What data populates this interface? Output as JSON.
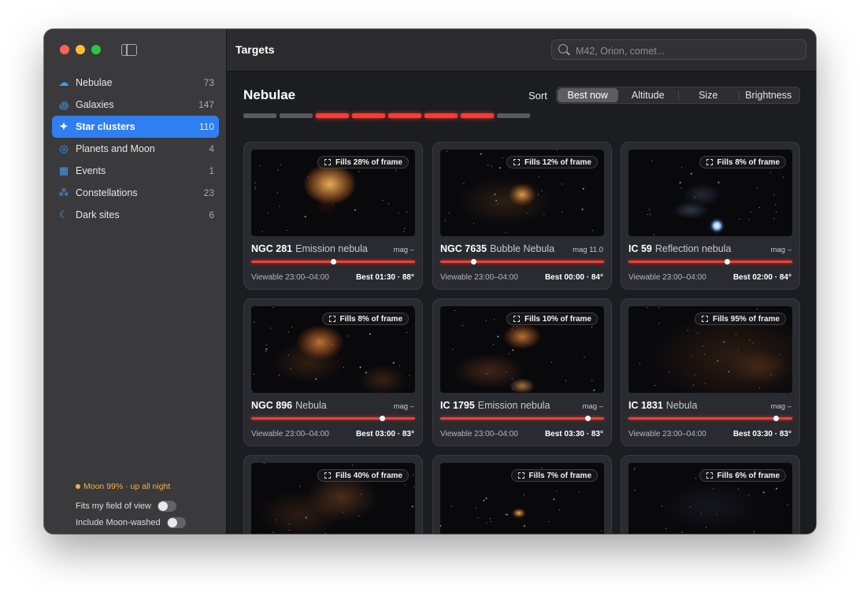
{
  "window": {
    "title": "Targets"
  },
  "search": {
    "placeholder": "M42, Orion, comet..."
  },
  "sidebar": {
    "items": [
      {
        "label": "Nebulae",
        "count": "73",
        "icon": "cloud-icon"
      },
      {
        "label": "Galaxies",
        "count": "147",
        "icon": "galaxy-icon"
      },
      {
        "label": "Star clusters",
        "count": "110",
        "icon": "sparkles-icon",
        "active": true
      },
      {
        "label": "Planets and Moon",
        "count": "4",
        "icon": "planet-icon"
      },
      {
        "label": "Events",
        "count": "1",
        "icon": "calendar-icon"
      },
      {
        "label": "Constellations",
        "count": "23",
        "icon": "constellation-icon"
      },
      {
        "label": "Dark sites",
        "count": "6",
        "icon": "moon-icon"
      }
    ],
    "footer": {
      "moon": "Moon 99% · up all night",
      "fits_fov": "Fits my field of view",
      "include_moon_washed": "Include Moon-washed"
    }
  },
  "main": {
    "section_title": "Nebulae",
    "sort_label": "Sort",
    "sort_options": [
      "Best now",
      "Altitude",
      "Size",
      "Brightness"
    ],
    "sort_selected": "Best now",
    "histogram": [
      false,
      false,
      true,
      true,
      true,
      true,
      true,
      false
    ]
  },
  "cards": [
    {
      "id": "NGC 281",
      "type": "Emission nebula",
      "mag": "mag –",
      "fills": "Fills 28% of frame",
      "viewable": "Viewable 23:00–04:00",
      "best": "Best 01:30 · 88°",
      "altitude_marker": 0.5
    },
    {
      "id": "NGC 7635",
      "type": "Bubble Nebula",
      "mag": "mag 11.0",
      "fills": "Fills 12% of frame",
      "viewable": "Viewable 23:00–04:00",
      "best": "Best 00:00 · 84°",
      "altitude_marker": 0.2
    },
    {
      "id": "IC 59",
      "type": "Reflection nebula",
      "mag": "mag –",
      "fills": "Fills 8% of frame",
      "viewable": "Viewable 23:00–04:00",
      "best": "Best 02:00 · 84°",
      "altitude_marker": 0.6
    },
    {
      "id": "NGC 896",
      "type": "Nebula",
      "mag": "mag –",
      "fills": "Fills 8% of frame",
      "viewable": "Viewable 23:00–04:00",
      "best": "Best 03:00 · 83°",
      "altitude_marker": 0.8
    },
    {
      "id": "IC 1795",
      "type": "Emission nebula",
      "mag": "mag –",
      "fills": "Fills 10% of frame",
      "viewable": "Viewable 23:00–04:00",
      "best": "Best 03:30 · 83°",
      "altitude_marker": 0.9
    },
    {
      "id": "IC 1831",
      "type": "Nebula",
      "mag": "mag –",
      "fills": "Fills 95% of frame",
      "viewable": "Viewable 23:00–04:00",
      "best": "Best 03:30 · 83°",
      "altitude_marker": 0.9
    },
    {
      "id": "",
      "type": "",
      "mag": "",
      "fills": "Fills 40% of frame",
      "viewable": "",
      "best": "",
      "altitude_marker": null
    },
    {
      "id": "",
      "type": "",
      "mag": "",
      "fills": "Fills 7% of frame",
      "viewable": "",
      "best": "",
      "altitude_marker": null
    },
    {
      "id": "",
      "type": "",
      "mag": "",
      "fills": "Fills 6% of frame",
      "viewable": "",
      "best": "",
      "altitude_marker": null
    }
  ],
  "colors": {
    "accent": "#2f7ff0",
    "altitude_bar": "#ff3b30",
    "moon_warning": "#f0b44a"
  }
}
